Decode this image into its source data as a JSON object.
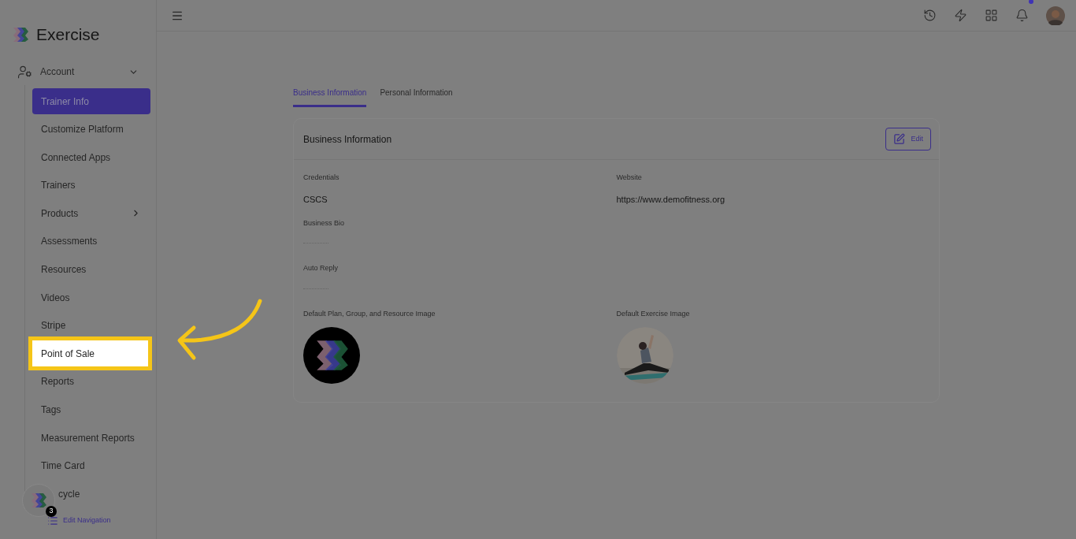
{
  "sidebar": {
    "brand": "Exercise",
    "account": {
      "label": "Account",
      "expanded": true
    },
    "items": [
      {
        "label": "Trainer Info",
        "selected": true,
        "highlighted": false,
        "kind": "link"
      },
      {
        "label": "Customize Platform",
        "selected": false,
        "highlighted": false,
        "kind": "link"
      },
      {
        "label": "Connected Apps",
        "selected": false,
        "highlighted": false,
        "kind": "link"
      },
      {
        "label": "Trainers",
        "selected": false,
        "highlighted": false,
        "kind": "link"
      },
      {
        "label": "Products",
        "selected": false,
        "highlighted": false,
        "kind": "group"
      },
      {
        "label": "Assessments",
        "selected": false,
        "highlighted": false,
        "kind": "link"
      },
      {
        "label": "Resources",
        "selected": false,
        "highlighted": false,
        "kind": "link"
      },
      {
        "label": "Videos",
        "selected": false,
        "highlighted": false,
        "kind": "link"
      },
      {
        "label": "Stripe",
        "selected": false,
        "highlighted": false,
        "kind": "link"
      },
      {
        "label": "Point of Sale",
        "selected": false,
        "highlighted": true,
        "kind": "link"
      },
      {
        "label": "Reports",
        "selected": false,
        "highlighted": false,
        "kind": "link"
      },
      {
        "label": "Tags",
        "selected": false,
        "highlighted": false,
        "kind": "link"
      },
      {
        "label": "Measurement Reports",
        "selected": false,
        "highlighted": false,
        "kind": "link"
      },
      {
        "label": "Time Card",
        "selected": false,
        "highlighted": false,
        "kind": "link"
      },
      {
        "label": "cycle",
        "selected": false,
        "highlighted": false,
        "kind": "link"
      }
    ],
    "helper_badge": "3",
    "edit_navigation": "Edit Navigation"
  },
  "header": {
    "notification_dot": true
  },
  "tabs": [
    {
      "label": "Business Information",
      "selected": true
    },
    {
      "label": "Personal Information",
      "selected": false
    }
  ],
  "card": {
    "title": "Business Information",
    "edit_button": "Edit",
    "fields": [
      {
        "label": "Credentials",
        "value": "CSCS",
        "kind": "text"
      },
      {
        "label": "Website",
        "value": "https://www.demofitness.org",
        "kind": "text"
      },
      {
        "label": "Business Bio",
        "kind": "empty"
      },
      {
        "label": "Auto Reply",
        "kind": "empty"
      },
      {
        "label": "Default Plan, Group, and Resource Image",
        "kind": "logo"
      },
      {
        "label": "Default Exercise Image",
        "kind": "picture"
      }
    ]
  }
}
